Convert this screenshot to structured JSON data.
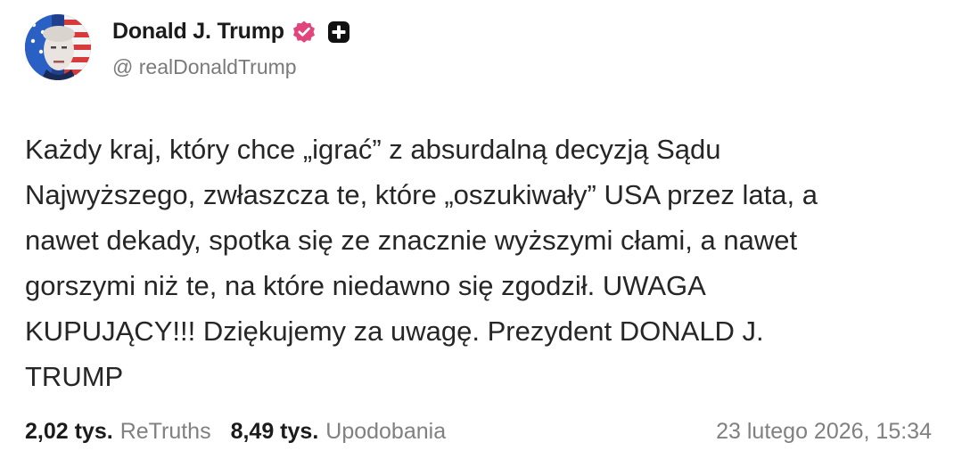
{
  "author": {
    "display_name": "Donald J. Trump",
    "handle": "@ realDonaldTrump",
    "verified_badge_color": "#e0457b"
  },
  "post": {
    "text": "Każdy kraj, który chce „igrać” z absurdalną decyzją Sądu\nNajwyższego, zwłaszcza te, które „oszukiwały” USA przez lata, a\nnawet dekady, spotka się ze znacznie wyższymi cłami, a nawet\ngorszymi niż te, na które niedawno się zgodził. UWAGA\nKUPUJĄCY!!! Dziękujemy za uwagę. Prezydent DONALD J.\nTRUMP"
  },
  "stats": {
    "retruths_count": "2,02 tys.",
    "retruths_label": "ReTruths",
    "likes_count": "8,49 tys.",
    "likes_label": "Upodobania"
  },
  "timestamp": "23 lutego 2026, 15:34",
  "icons": {
    "verified": "verified-badge-icon",
    "plus": "plus-badge-icon"
  }
}
